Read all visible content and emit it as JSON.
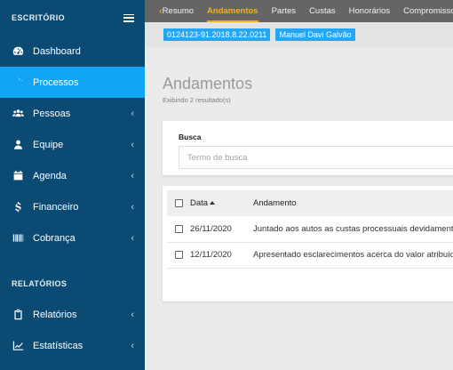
{
  "sidebar": {
    "section1": "ESCRITÓRIO",
    "section2": "RELATÓRIOS",
    "items": [
      {
        "label": "Dashboard",
        "icon": "dashboard-icon",
        "active": false,
        "chevron": false
      },
      {
        "label": "Processos",
        "icon": "scale-icon",
        "active": true,
        "chevron": false
      },
      {
        "label": "Pessoas",
        "icon": "users-icon",
        "active": false,
        "chevron": true
      },
      {
        "label": "Equipe",
        "icon": "user-icon",
        "active": false,
        "chevron": true
      },
      {
        "label": "Agenda",
        "icon": "calendar-icon",
        "active": false,
        "chevron": true
      },
      {
        "label": "Financeiro",
        "icon": "dollar-icon",
        "active": false,
        "chevron": true
      },
      {
        "label": "Cobrança",
        "icon": "barcode-icon",
        "active": false,
        "chevron": true
      }
    ],
    "report_items": [
      {
        "label": "Relatórios",
        "icon": "clipboard-icon",
        "chevron": true
      },
      {
        "label": "Estatísticas",
        "icon": "line-chart-icon",
        "chevron": true
      }
    ],
    "chevron_glyph": "‹"
  },
  "topbar": {
    "back_glyph": "‹",
    "tabs": [
      "Resumo",
      "Andamentos",
      "Partes",
      "Custas",
      "Honorários",
      "Compromissos"
    ],
    "active_tab": "Andamentos"
  },
  "badges": {
    "process_number": "0124123-91.2018.8.22.0211",
    "client_name": "Manuel Davi Galvão"
  },
  "main": {
    "title": "Andamentos",
    "subtitle": "Exibindo 2 resultado(s)",
    "search": {
      "label": "Busca",
      "placeholder": "Termo de busca"
    },
    "table": {
      "headers": {
        "date": "Data",
        "event": "Andamento"
      },
      "rows": [
        {
          "date": "26/11/2020",
          "event": "Juntado aos autos as custas processuais devidamente pagas"
        },
        {
          "date": "12/11/2020",
          "event": "Apresentado esclarecimentos acerca do valor atribuído"
        }
      ]
    }
  },
  "colors": {
    "sidebar": "#0b4a73",
    "active": "#13a5f5",
    "accent": "#f5b21b",
    "badge": "#26a6f0"
  }
}
